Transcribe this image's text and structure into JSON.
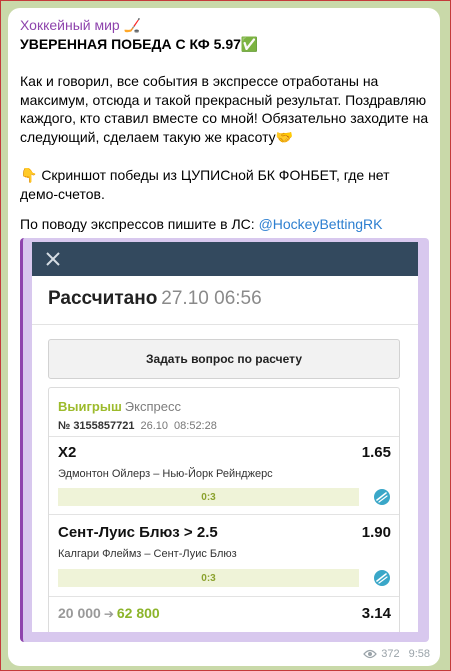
{
  "post": {
    "channel_name": "Хоккейный мир 🏒",
    "heading": "УВЕРЕННАЯ ПОБЕДА С КФ 5.97✅",
    "paragraph1": "Как и говорил, все события в экспрессе отработаны на максимум, отсюда и такой прекрасный результат. Поздравляю каждого, кто ставил вместе со мной! Обязательно заходите на следующий, сделаем такую же красоту🤝",
    "paragraph2": "👇 Скриншот победы из ЦУПИСной БК ФОНБЕТ, где нет демо-счетов.",
    "paragraph3_prefix": "По поводу экспрессов пишите в ЛС: ",
    "mention": "@HockeyBettingRK",
    "views": "372",
    "time": "9:58"
  },
  "screenshot": {
    "title": "Рассчитано",
    "datetime": "27.10 06:56",
    "ask_button": "Задать вопрос по расчету",
    "bet": {
      "status": "Выигрыш",
      "type": "Экспресс",
      "number": "№ 3155857721",
      "date": "26.10",
      "time": "08:52:28",
      "selections": [
        {
          "market": "X2",
          "odds": "1.65",
          "event": "Эдмонтон Ойлерз – Нью-Йорк Рейнджерс",
          "score": "0:3"
        },
        {
          "market": "Сент-Луис Блюз > 2.5",
          "odds": "1.90",
          "event": "Калгари Флеймз – Сент-Луис Блюз",
          "score": "0:3"
        }
      ],
      "stake": "20 000",
      "payout": "62 800",
      "total_odds": "3.14"
    }
  },
  "colors": {
    "accent_purple": "#8e44ad",
    "mention_blue": "#2d7fd0",
    "win_green": "#9dbb2c",
    "header_navy": "#33495e",
    "puck_icon": "#3aa7c8"
  }
}
